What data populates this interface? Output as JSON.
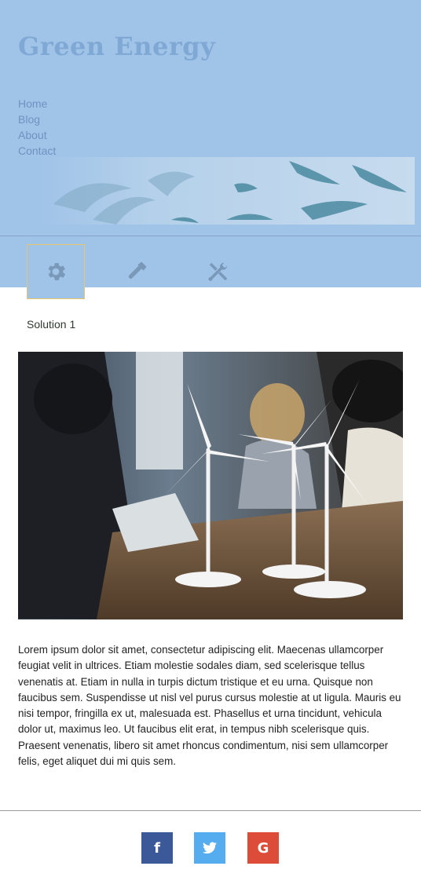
{
  "site": {
    "title": "Green Energy"
  },
  "nav": {
    "items": [
      "Home",
      "Blog",
      "About",
      "Contact"
    ]
  },
  "tabs": {
    "items": [
      {
        "icon": "gear-icon",
        "active": true
      },
      {
        "icon": "hammer-icon",
        "active": false
      },
      {
        "icon": "tools-icon",
        "active": false
      }
    ],
    "active_label": "Solution 1"
  },
  "article": {
    "text": "Lorem ipsum dolor sit amet, consectetur adipiscing elit. Maecenas ullamcorper feugiat velit in ultrices. Etiam molestie sodales diam, sed scelerisque tellus venenatis at. Etiam in nulla in turpis dictum tristique et eu urna. Quisque non faucibus sem. Suspendisse ut nisl vel purus cursus molestie at ut ligula. Mauris eu nisi tempor, fringilla ex ut, malesuada est. Phasellus et urna tincidunt, vehicula dolor ut, maximus leo. Ut faucibus elit erat, in tempus nibh scelerisque quis. Praesent venenatis, libero sit amet rhoncus condimentum, nisi sem ullamcorper felis, eget aliquet dui mi quis sem."
  },
  "social": {
    "facebook": {
      "glyph": "f",
      "color": "#3b5998"
    },
    "twitter": {
      "glyph": "twitter-bird",
      "color": "#55acee"
    },
    "google": {
      "glyph": "G",
      "color": "#dd4b39"
    }
  },
  "colors": {
    "header_bg": "#a0c3e8",
    "title": "#7fa9d4",
    "nav": "#6e93c2",
    "active_tab_border": "#e8c46a"
  }
}
